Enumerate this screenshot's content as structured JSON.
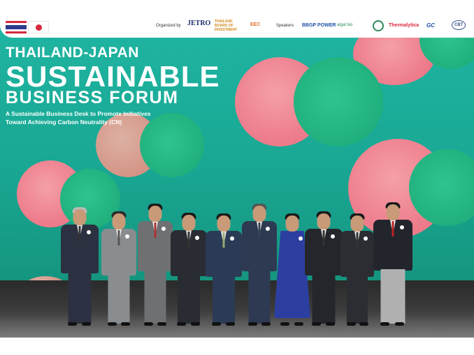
{
  "event": {
    "title_line1": "THAILAND-JAPAN",
    "title_line2": "SUSTAINABLE",
    "title_line3": "BUSINESS FORUM",
    "subtitle_line1": "A Sustainable Business Desk to Promote Initiatives",
    "subtitle_line2": "Toward Achieving Carbon Neutrality (CN)"
  },
  "header": {
    "organized_by": "Organized by",
    "speakers_label": "Speakers",
    "logos": {
      "jetro": "JETRO",
      "boi": "THAILAND BOARD OF INVESTMENT",
      "eec": "EEC",
      "bbgp": "BBGP POWER",
      "algal": "algal bio",
      "thermalytica": "Thermalytica",
      "gc": "GC",
      "cbt": "CBT"
    },
    "flags": [
      "thailand-flag",
      "japan-flag"
    ]
  },
  "colors": {
    "backdrop_teal": "#1fb5a2",
    "circle_pink": "#ee7f8e",
    "circle_green": "#20b07e",
    "stage_dark": "#2a2a2a"
  },
  "people_count": 10
}
